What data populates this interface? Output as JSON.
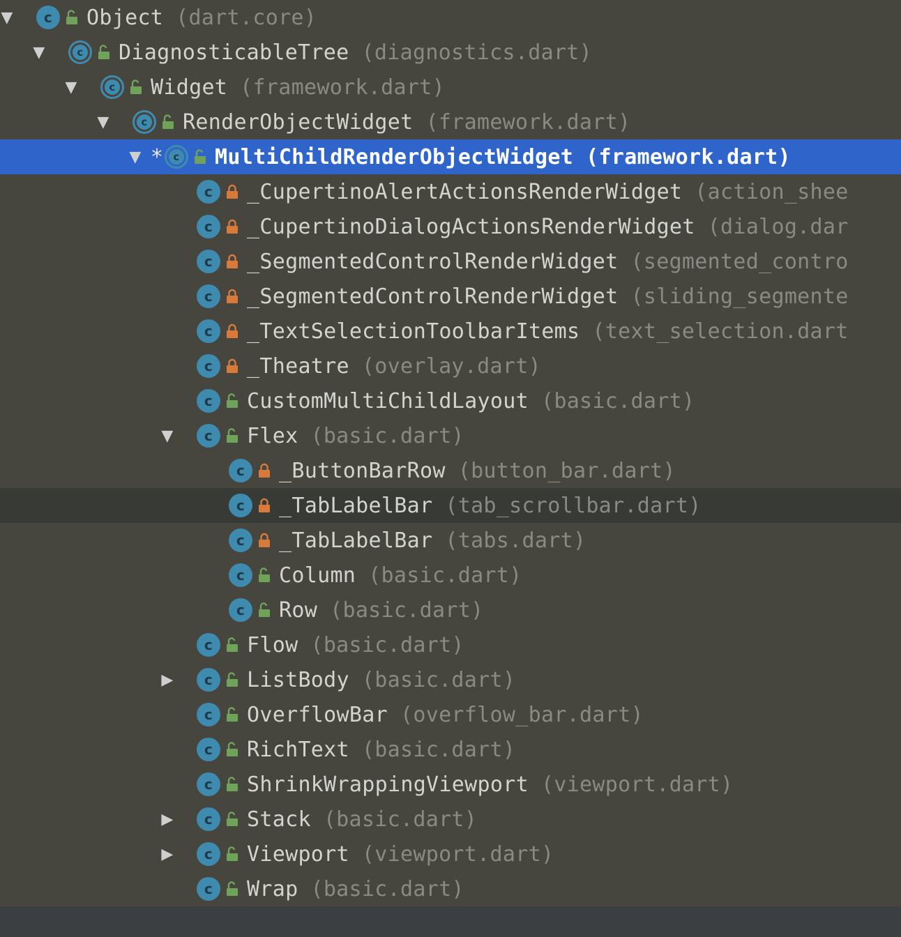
{
  "colors": {
    "background": "#46463f",
    "selection": "#2f65ca",
    "class_icon": "#3f8bb0",
    "public_icon": "#6fa35a",
    "private_icon": "#d77a3b"
  },
  "rows": [
    {
      "indent": 0,
      "arrow": "open",
      "star": false,
      "abstract": false,
      "vis": "public",
      "name": "Object",
      "file": "(dart.core)"
    },
    {
      "indent": 1,
      "arrow": "open",
      "star": false,
      "abstract": true,
      "vis": "public",
      "name": "DiagnosticableTree",
      "file": "(diagnostics.dart)"
    },
    {
      "indent": 2,
      "arrow": "open",
      "star": false,
      "abstract": true,
      "vis": "public",
      "name": "Widget",
      "file": "(framework.dart)"
    },
    {
      "indent": 3,
      "arrow": "open",
      "star": false,
      "abstract": true,
      "vis": "public",
      "name": "RenderObjectWidget",
      "file": "(framework.dart)"
    },
    {
      "indent": 4,
      "arrow": "open",
      "star": true,
      "abstract": true,
      "vis": "public",
      "name": "MultiChildRenderObjectWidget",
      "file": "(framework.dart)",
      "selected": true
    },
    {
      "indent": 5,
      "arrow": "",
      "star": false,
      "abstract": false,
      "vis": "private",
      "name": "_CupertinoAlertActionsRenderWidget",
      "file": "(action_shee"
    },
    {
      "indent": 5,
      "arrow": "",
      "star": false,
      "abstract": false,
      "vis": "private",
      "name": "_CupertinoDialogActionsRenderWidget",
      "file": "(dialog.dar"
    },
    {
      "indent": 5,
      "arrow": "",
      "star": false,
      "abstract": false,
      "vis": "private",
      "name": "_SegmentedControlRenderWidget",
      "file": "(segmented_contro"
    },
    {
      "indent": 5,
      "arrow": "",
      "star": false,
      "abstract": false,
      "vis": "private",
      "name": "_SegmentedControlRenderWidget",
      "file": "(sliding_segmente"
    },
    {
      "indent": 5,
      "arrow": "",
      "star": false,
      "abstract": false,
      "vis": "private",
      "name": "_TextSelectionToolbarItems",
      "file": "(text_selection.dart"
    },
    {
      "indent": 5,
      "arrow": "",
      "star": false,
      "abstract": false,
      "vis": "private",
      "name": "_Theatre",
      "file": "(overlay.dart)"
    },
    {
      "indent": 5,
      "arrow": "",
      "star": false,
      "abstract": false,
      "vis": "public",
      "name": "CustomMultiChildLayout",
      "file": "(basic.dart)"
    },
    {
      "indent": 5,
      "arrow": "open",
      "star": false,
      "abstract": false,
      "vis": "public",
      "name": "Flex",
      "file": "(basic.dart)"
    },
    {
      "indent": 6,
      "arrow": "",
      "star": false,
      "abstract": false,
      "vis": "private",
      "name": "_ButtonBarRow",
      "file": "(button_bar.dart)"
    },
    {
      "indent": 6,
      "arrow": "",
      "star": false,
      "abstract": false,
      "vis": "private",
      "name": "_TabLabelBar",
      "file": "(tab_scrollbar.dart)",
      "hover": true
    },
    {
      "indent": 6,
      "arrow": "",
      "star": false,
      "abstract": false,
      "vis": "private",
      "name": "_TabLabelBar",
      "file": "(tabs.dart)"
    },
    {
      "indent": 6,
      "arrow": "",
      "star": false,
      "abstract": false,
      "vis": "public",
      "name": "Column",
      "file": "(basic.dart)"
    },
    {
      "indent": 6,
      "arrow": "",
      "star": false,
      "abstract": false,
      "vis": "public",
      "name": "Row",
      "file": "(basic.dart)"
    },
    {
      "indent": 5,
      "arrow": "",
      "star": false,
      "abstract": false,
      "vis": "public",
      "name": "Flow",
      "file": "(basic.dart)"
    },
    {
      "indent": 5,
      "arrow": "closed",
      "star": false,
      "abstract": false,
      "vis": "public",
      "name": "ListBody",
      "file": "(basic.dart)"
    },
    {
      "indent": 5,
      "arrow": "",
      "star": false,
      "abstract": false,
      "vis": "public",
      "name": "OverflowBar",
      "file": "(overflow_bar.dart)"
    },
    {
      "indent": 5,
      "arrow": "",
      "star": false,
      "abstract": false,
      "vis": "public",
      "name": "RichText",
      "file": "(basic.dart)"
    },
    {
      "indent": 5,
      "arrow": "",
      "star": false,
      "abstract": false,
      "vis": "public",
      "name": "ShrinkWrappingViewport",
      "file": "(viewport.dart)"
    },
    {
      "indent": 5,
      "arrow": "closed",
      "star": false,
      "abstract": false,
      "vis": "public",
      "name": "Stack",
      "file": "(basic.dart)"
    },
    {
      "indent": 5,
      "arrow": "closed",
      "star": false,
      "abstract": false,
      "vis": "public",
      "name": "Viewport",
      "file": "(viewport.dart)"
    },
    {
      "indent": 5,
      "arrow": "",
      "star": false,
      "abstract": false,
      "vis": "public",
      "name": "Wrap",
      "file": "(basic.dart)"
    }
  ]
}
